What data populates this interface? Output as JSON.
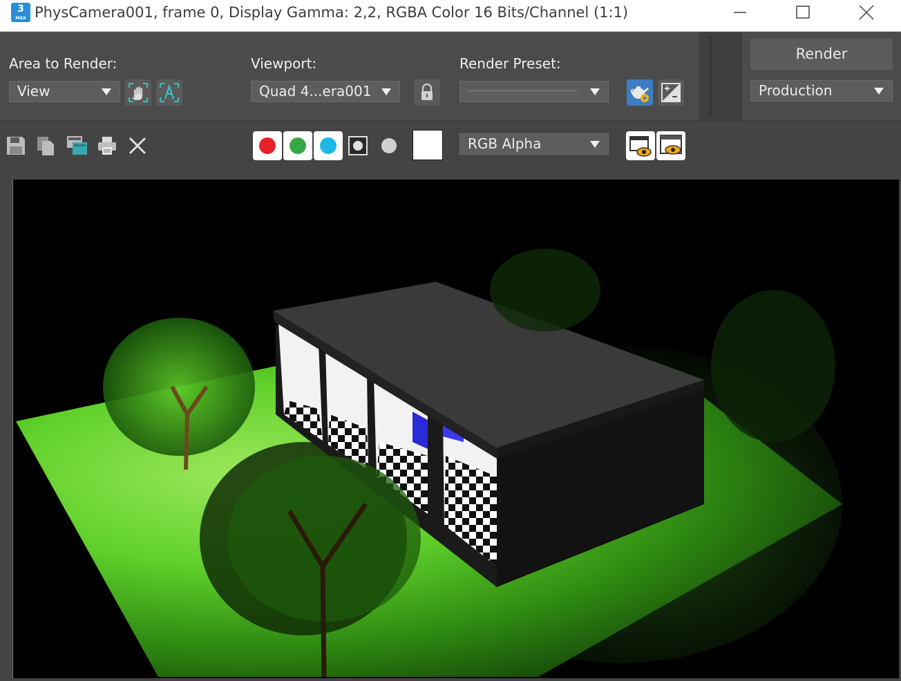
{
  "window": {
    "title": "PhysCamera001, frame 0, Display Gamma: 2,2, RGBA Color 16 Bits/Channel (1:1)",
    "app_icon_number": "3",
    "app_icon_text": "MAX"
  },
  "area_to_render": {
    "label": "Area to Render:",
    "value": "View"
  },
  "viewport": {
    "label": "Viewport:",
    "value": "Quad 4...era001"
  },
  "render_preset": {
    "label": "Render Preset:",
    "value": ""
  },
  "render_button": {
    "label": "Render"
  },
  "production": {
    "value": "Production"
  },
  "channel_display": {
    "value": "RGB Alpha"
  },
  "channel_colors": {
    "red": "#e8202a",
    "green": "#35a845",
    "blue": "#1fb8e8"
  },
  "icons": [
    "save-icon",
    "copy-icon",
    "clone-window-icon",
    "print-icon",
    "close-icon",
    "lock-icon",
    "render-setup-teapot-icon",
    "exposure-icon",
    "region-hand-icon",
    "auto-region-icon",
    "display-toggle-icon",
    "frame-buffer-icon",
    "show-window-icon"
  ]
}
